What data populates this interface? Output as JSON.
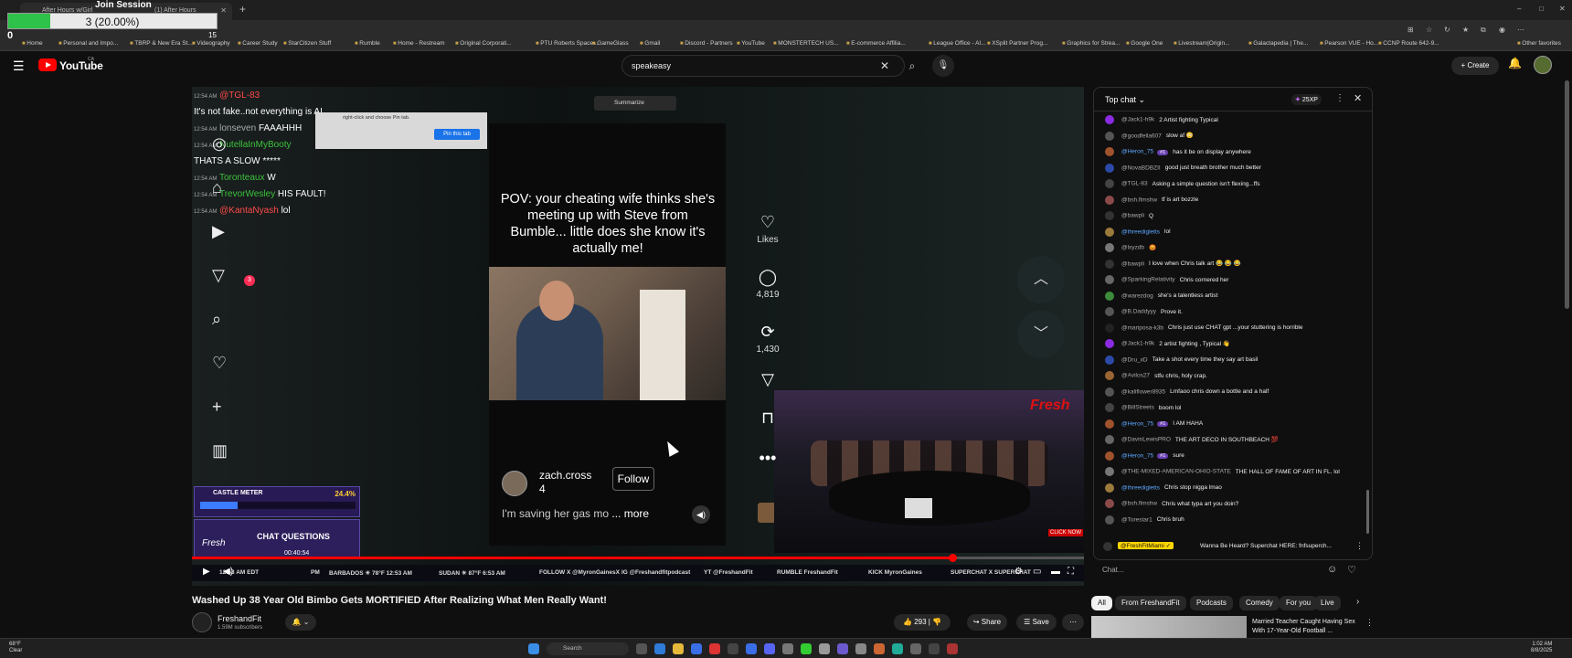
{
  "browser": {
    "tabs": [
      {
        "label": "After Hours w/Girl",
        "active": true
      },
      {
        "label": "(1) After Hours w/Girls - YouTube",
        "active": false
      }
    ],
    "new_tab_label": "+",
    "window_controls": [
      "–",
      "□",
      "✕"
    ],
    "bookmarks": [
      "Home",
      "Personal and Impo...",
      "TBRP & New Era St...",
      "Videography",
      "Career Study",
      "StarCitizen Stuff",
      "Rumble",
      "Home - Restream",
      "Original Corporati...",
      "PTU Roberts Space...",
      "GameGlass",
      "Gmail",
      "Discord - Partners",
      "YouTube",
      "MONSTERTECH US...",
      "E-commerce Affilia...",
      "League Office - AI...",
      "XSplit Partner Prog...",
      "Graphics for Strea...",
      "Google One",
      "Livestream|Origin...",
      "Galactapedia | The...",
      "Pearson VUE - Ho...",
      "CCNP Route 642-9...",
      "Other favorites"
    ]
  },
  "join_session": {
    "title": "Join Session",
    "progress_text": "3 (20.00%)",
    "progress_value": 0.2,
    "min_label": "0",
    "max_label": "15",
    "fill_color": "#2ec24a"
  },
  "youtube": {
    "logo_text": "YouTube",
    "country_code": "CA",
    "search_value": "speakeasy",
    "create_label": "Create",
    "brand_color": "#ff0000"
  },
  "player": {
    "overlay_chat": [
      {
        "ts": "12:54 AM",
        "author": "@TGL-83",
        "text": "",
        "color": "#ff4a4a"
      },
      {
        "ts": "",
        "author": "",
        "text": "It's not fake..not everything is AI",
        "color": "#ffffff"
      },
      {
        "ts": "12:54 AM",
        "author": "lonseven",
        "text": "FAAAHHH",
        "color": "#aaaaaa"
      },
      {
        "ts": "12:54 AM",
        "author": "NutellaInMyBooty",
        "text": "",
        "color": "#3cc23c"
      },
      {
        "ts": "",
        "author": "",
        "text": "THATS A SLOW *****",
        "color": "#ffffff"
      },
      {
        "ts": "12:54 AM",
        "author": "Toronteaux",
        "text": "W",
        "color": "#3cc23c"
      },
      {
        "ts": "12:54 AM",
        "author": "TrevorWesley",
        "text": "HIS FAULT!",
        "color": "#3cc23c"
      },
      {
        "ts": "12:54 AM",
        "author": "@KantaNyash",
        "text": "lol",
        "color": "#ff4a4a"
      }
    ],
    "pin_hint": "right-click and choose Pin tab.",
    "pin_button": "Pin this tab",
    "summarize_label": "Summarize",
    "tiktok": {
      "caption": "POV: your cheating wife thinks she's meeting up with Steve from Bumble... little does she know it's actually me!",
      "username": "zach.cross",
      "user_number": "4",
      "follow_label": "Follow",
      "description": "I'm saving her gas mo",
      "more_label": "... more",
      "actions": [
        {
          "icon": "heart-icon",
          "glyph": "♡",
          "count": "Likes"
        },
        {
          "icon": "comment-icon",
          "glyph": "◯",
          "count": "4,819"
        },
        {
          "icon": "repost-icon",
          "glyph": "⟳",
          "count": "1,430"
        },
        {
          "icon": "send-icon",
          "glyph": "▽",
          "count": ""
        },
        {
          "icon": "bookmark-icon",
          "glyph": "⊓",
          "count": ""
        },
        {
          "icon": "more-icon",
          "glyph": "•••",
          "count": ""
        }
      ],
      "inbox_badge": "3"
    },
    "castle_meter": {
      "title": "CASTLE METER",
      "percent_text": "24.4%",
      "value": 0.244
    },
    "chat_questions": {
      "brand": "Fresh",
      "title": "CHAT QUESTIONS",
      "timer": "00:40:54"
    },
    "studio": {
      "logo": "Fresh",
      "click_label": "CLICK NOW",
      "sign": "BUMBLE CONFIDENTIAL"
    },
    "ticker": [
      "12:53 AM EDT",
      "PM",
      "BARBADOS ☀ 78°F 12:53 AM",
      "SUDAN ☀ 87°F 6:53 AM",
      "FOLLOW  X @MyronGainesX",
      "IG @Freshandfitpodcast",
      "YT @FreshandFit",
      "RUMBLE FreshandFit",
      "KICK MyronGaines",
      "SUPERCHAT X SUPERCHAT"
    ],
    "playback_progress": 0.852
  },
  "video": {
    "title": "Washed Up 38 Year Old Bimbo Gets MORTIFIED After Realizing What Men Really Want!",
    "channel": "FreshandFit",
    "subscribers": "1.59M subscribers",
    "likes": "293",
    "share_label": "Share",
    "save_label": "Save"
  },
  "chat": {
    "title": "Top chat",
    "xp": "25XP",
    "messages": [
      {
        "author": "@Jack1-h9k",
        "text": "2 Artist fighting Typical",
        "member": false,
        "badge": "",
        "av": "#8a2be2"
      },
      {
        "author": "@goodfella607",
        "text": "slow af 😳",
        "member": false,
        "badge": "",
        "av": "#555"
      },
      {
        "author": "@Heron_75",
        "text": "has it be on display anywhere",
        "member": true,
        "badge": "#1",
        "av": "#a0522d"
      },
      {
        "author": "@NovaBDBZII",
        "text": "good just breath brother much better",
        "member": false,
        "badge": "",
        "av": "#2b4aa8"
      },
      {
        "author": "@TGL-83",
        "text": "Asking a simple question isn't flexing...ffs",
        "member": false,
        "badge": "",
        "av": "#444"
      },
      {
        "author": "@bsh.flmshw",
        "text": "tf is art bozzle",
        "member": false,
        "badge": "",
        "av": "#8b4a4a"
      },
      {
        "author": "@bawpli",
        "text": "Q",
        "member": false,
        "badge": "",
        "av": "#333"
      },
      {
        "author": "@threedigletts",
        "text": "lol",
        "member": true,
        "badge": "",
        "av": "#9c7a3c"
      },
      {
        "author": "@lxyzdb",
        "text": "😡",
        "member": false,
        "badge": "",
        "av": "#777"
      },
      {
        "author": "@bawpli",
        "text": "I love when Chris talk art 😂 😂 😂",
        "member": false,
        "badge": "",
        "av": "#333"
      },
      {
        "author": "@SparkingRelativity",
        "text": "Chris cornered her",
        "member": false,
        "badge": "",
        "av": "#666"
      },
      {
        "author": "@warezdog",
        "text": "she's a talentless artist",
        "member": false,
        "badge": "",
        "av": "#3c8c3c"
      },
      {
        "author": "@B.Daddyyy",
        "text": "Prove it.",
        "member": false,
        "badge": "",
        "av": "#555"
      },
      {
        "author": "@mariposa-k3b",
        "text": "Chris just use CHAT gpt ...your stuttering is horrible",
        "member": false,
        "badge": "",
        "av": "#222"
      },
      {
        "author": "@Jack1-h9k",
        "text": "2 artist fighting , Typical 👋",
        "member": false,
        "badge": "",
        "av": "#8a2be2"
      },
      {
        "author": "@Dru_xD",
        "text": "Take a shot every time they say art basil",
        "member": false,
        "badge": "",
        "av": "#2b4aa8"
      },
      {
        "author": "@Avilos27",
        "text": "stfu chris, holy crap.",
        "member": false,
        "badge": "",
        "av": "#996633"
      },
      {
        "author": "@kaliflower8935",
        "text": "Lmfaoo chris down a bottle and a half",
        "member": false,
        "badge": "",
        "av": "#555"
      },
      {
        "author": "@BillStreets",
        "text": "boom lol",
        "member": false,
        "badge": "",
        "av": "#444"
      },
      {
        "author": "@Heron_75",
        "text": "I AM HAHA",
        "member": true,
        "badge": "#1",
        "av": "#a0522d"
      },
      {
        "author": "@DavinLewisPRO",
        "text": "THE ART DECO IN SOUTHBEACH 💯",
        "member": false,
        "badge": "",
        "av": "#666"
      },
      {
        "author": "@Heron_75",
        "text": "sure",
        "member": true,
        "badge": "#1",
        "av": "#a0522d"
      },
      {
        "author": "@THE-MIXED-AMERICAN-OHIO-STATE",
        "text": "THE HALL OF FAME OF ART IN FL. lol",
        "member": false,
        "badge": "",
        "av": "#777"
      },
      {
        "author": "@threedigletts",
        "text": "Chris stop nigga lmao",
        "member": true,
        "badge": "",
        "av": "#9c7a3c"
      },
      {
        "author": "@bsh.flmshw",
        "text": "Chris what typa art you doin?",
        "member": false,
        "badge": "",
        "av": "#8b4a4a"
      },
      {
        "author": "@Torestar1",
        "text": "Chris bruh",
        "member": false,
        "badge": "",
        "av": "#555"
      }
    ],
    "pinned": {
      "author": "@FreshFitMiami ✓",
      "text": "Wanna Be Heard? Superchat HERE: fnfsuperch..."
    },
    "input_placeholder": "Chat..."
  },
  "chips": [
    "All",
    "From FreshandFit",
    "Podcasts",
    "Comedy",
    "For you",
    "Live"
  ],
  "recommendation": {
    "title": "Married Teacher Caught Having Sex With 17-Year-Old Football ..."
  },
  "taskbar": {
    "weather_temp": "68°F",
    "weather_desc": "Clear",
    "search_label": "Search",
    "time": "1:02 AM",
    "date": "8/8/2025"
  }
}
